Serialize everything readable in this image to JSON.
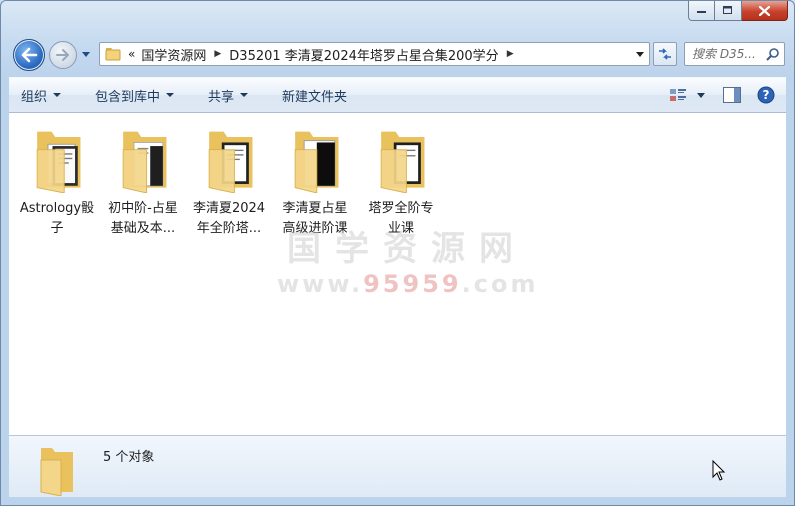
{
  "window": {
    "colors": {
      "accent": "#2d6cc2",
      "close": "#c7432c",
      "folder": "#f2d27a"
    }
  },
  "nav": {
    "breadcrumb": [
      "国学资源网",
      "D35201 李清夏2024年塔罗占星合集200学分"
    ],
    "overflow_marker": "«",
    "search_placeholder": "搜索 D35..."
  },
  "toolbar": {
    "organize": "组织",
    "include_in_library": "包含到库中",
    "share": "共享",
    "new_folder": "新建文件夹"
  },
  "items": [
    {
      "name": "Astrology骰子",
      "label_line1": "Astrology骰",
      "label_line2": "子"
    },
    {
      "name": "初中阶-占星基础及本...",
      "label_line1": "初中阶-占星",
      "label_line2": "基础及本..."
    },
    {
      "name": "李清夏2024年全阶塔...",
      "label_line1": "李清夏2024",
      "label_line2": "年全阶塔..."
    },
    {
      "name": "李清夏占星高级进阶课",
      "label_line1": "李清夏占星",
      "label_line2": "高级进阶课"
    },
    {
      "name": "塔罗全阶专业课",
      "label_line1": "塔罗全阶专",
      "label_line2": "业课"
    }
  ],
  "watermark": {
    "title": "国学资源网",
    "url_prefix": "www.",
    "url_accent": "95959",
    "url_suffix": ".com"
  },
  "details": {
    "count_text": "5 个对象"
  }
}
